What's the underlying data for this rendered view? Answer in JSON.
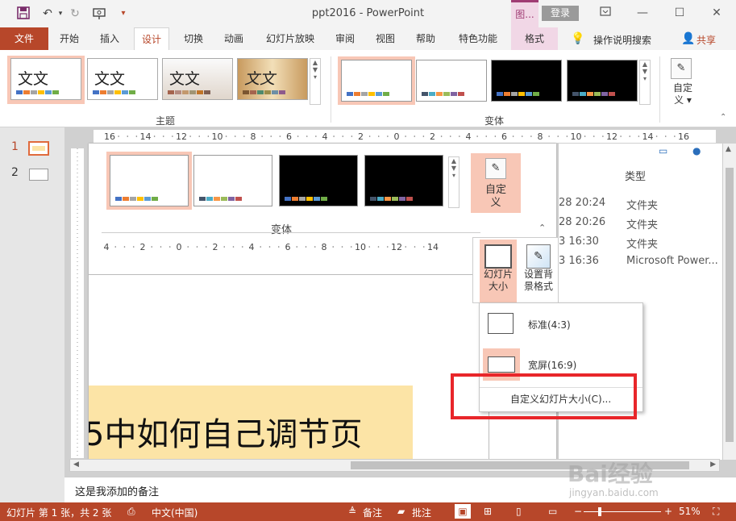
{
  "window": {
    "title": "ppt2016  -  PowerPoint",
    "context_tab": "图...",
    "login": "登录",
    "qat_more": "▾"
  },
  "tabs": [
    {
      "label": "文件"
    },
    {
      "label": "开始"
    },
    {
      "label": "插入"
    },
    {
      "label": "设计"
    },
    {
      "label": "切换"
    },
    {
      "label": "动画"
    },
    {
      "label": "幻灯片放映"
    },
    {
      "label": "审阅"
    },
    {
      "label": "视图"
    },
    {
      "label": "帮助"
    },
    {
      "label": "特色功能"
    },
    {
      "label": "格式"
    }
  ],
  "tell_me": "操作说明搜索",
  "share": "共享",
  "ribbon": {
    "theme_sample": "文文",
    "themes_label": "主题",
    "variants_label": "变体",
    "customize": "自定义",
    "customize_arrow": "▾"
  },
  "panel": {
    "variants_label": "变体",
    "customize_label": "自定\n义",
    "slide_size": "幻灯片\n大小",
    "format_bg": "设置背\n景格式"
  },
  "ruler_top": [
    "16",
    "14",
    "12",
    "10",
    "8",
    "6",
    "4",
    "2",
    "0",
    "2",
    "4",
    "6",
    "8",
    "10",
    "12",
    "14",
    "16"
  ],
  "ruler_inner": [
    "4",
    "2",
    "0",
    "2",
    "4",
    "6",
    "8",
    "10",
    "12",
    "14"
  ],
  "thumbnails": [
    {
      "num": "1"
    },
    {
      "num": "2"
    }
  ],
  "explorer": {
    "header": "类型",
    "rows": [
      {
        "time": "28 20:24",
        "type": "文件夹"
      },
      {
        "time": "28 20:26",
        "type": "文件夹"
      },
      {
        "time": "3 16:30",
        "type": "文件夹"
      },
      {
        "time": "3 16:36",
        "type": "Microsoft Power..."
      }
    ]
  },
  "slide_text": "5中如何自己调节页",
  "menu": {
    "standard": "标准(4:3)",
    "wide": "宽屏(16:9)",
    "custom": "自定义幻灯片大小(C)..."
  },
  "notes_text": "这是我添加的备注",
  "status": {
    "slide_info": "幻灯片 第 1 张，共 2 张",
    "language": "中文(中国)",
    "notes": "备注",
    "comments": "批注",
    "minus": "−",
    "plus": "+",
    "zoom": "51%"
  },
  "watermark": {
    "brand": "Bai经验",
    "url": "jingyan.baidu.com"
  },
  "colors": {
    "accent": "#b7472a",
    "context": "#a03d74",
    "highlight": "#f8c7b6",
    "red_box": "#e8262a",
    "slide_text_bg": "#fce4a6"
  }
}
